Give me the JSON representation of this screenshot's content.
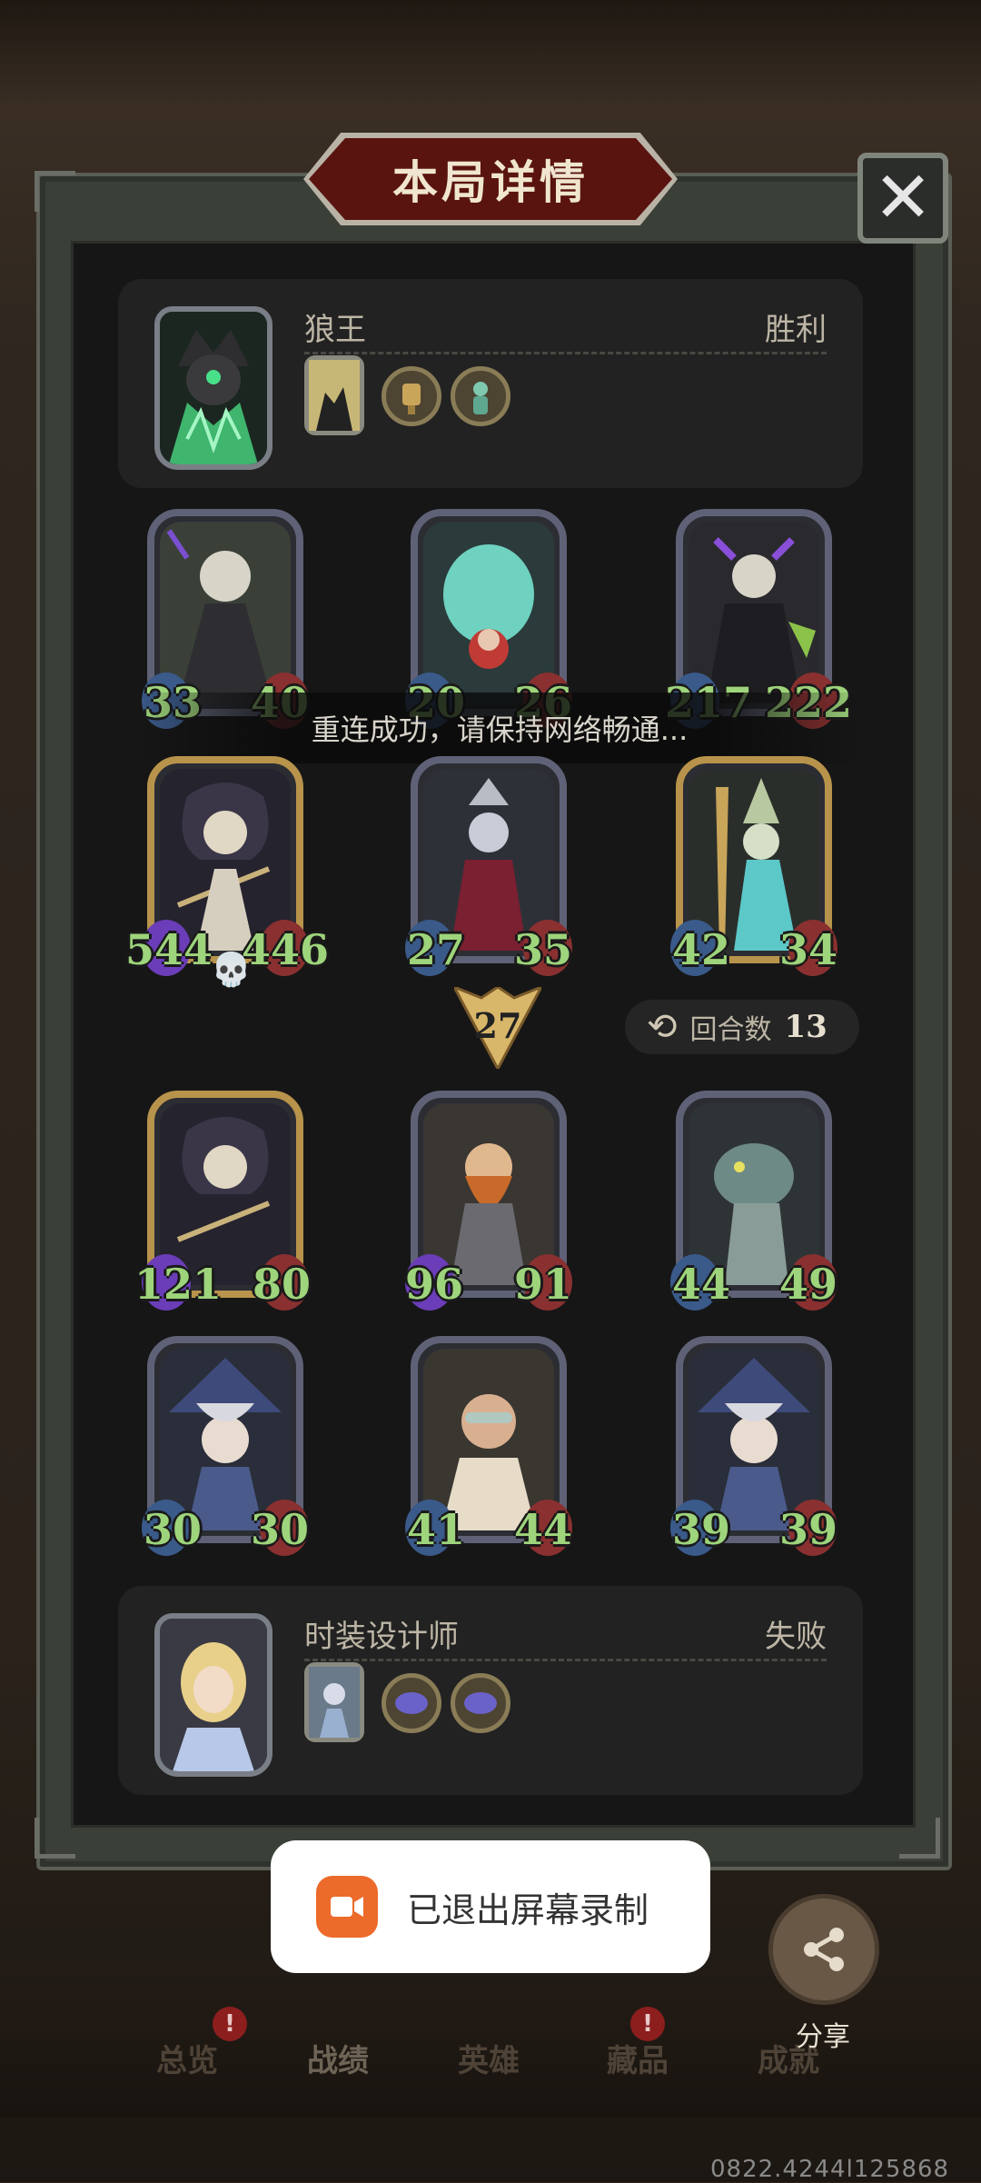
{
  "title": "本局详情",
  "close_icon": "close-icon",
  "top_player": {
    "name": "狼王",
    "result": "胜利"
  },
  "bottom_player": {
    "name": "时装设计师",
    "result": "失败"
  },
  "top_board": {
    "row1": [
      {
        "atk": "33",
        "hp": "40"
      },
      {
        "atk": "20",
        "hp": "26"
      },
      {
        "atk": "217",
        "hp": "222"
      }
    ],
    "row2": [
      {
        "atk": "544",
        "hp": "446"
      },
      {
        "atk": "27",
        "hp": "35"
      },
      {
        "atk": "42",
        "hp": "34"
      }
    ]
  },
  "damage": "27",
  "turn": {
    "label": "回合数",
    "value": "13"
  },
  "bottom_board": {
    "row1": [
      {
        "atk": "121",
        "hp": "80"
      },
      {
        "atk": "96",
        "hp": "91"
      },
      {
        "atk": "44",
        "hp": "49"
      }
    ],
    "row2": [
      {
        "atk": "30",
        "hp": "30"
      },
      {
        "atk": "41",
        "hp": "44"
      },
      {
        "atk": "39",
        "hp": "39"
      }
    ]
  },
  "reconnect_toast": "重连成功，请保持网络畅通...",
  "record_toast": "已退出屏幕录制",
  "share_label": "分享",
  "tabs": [
    "总览",
    "战绩",
    "英雄",
    "藏品",
    "成就"
  ],
  "badge_mark": "!",
  "footer_id": "0822.4244l125868"
}
